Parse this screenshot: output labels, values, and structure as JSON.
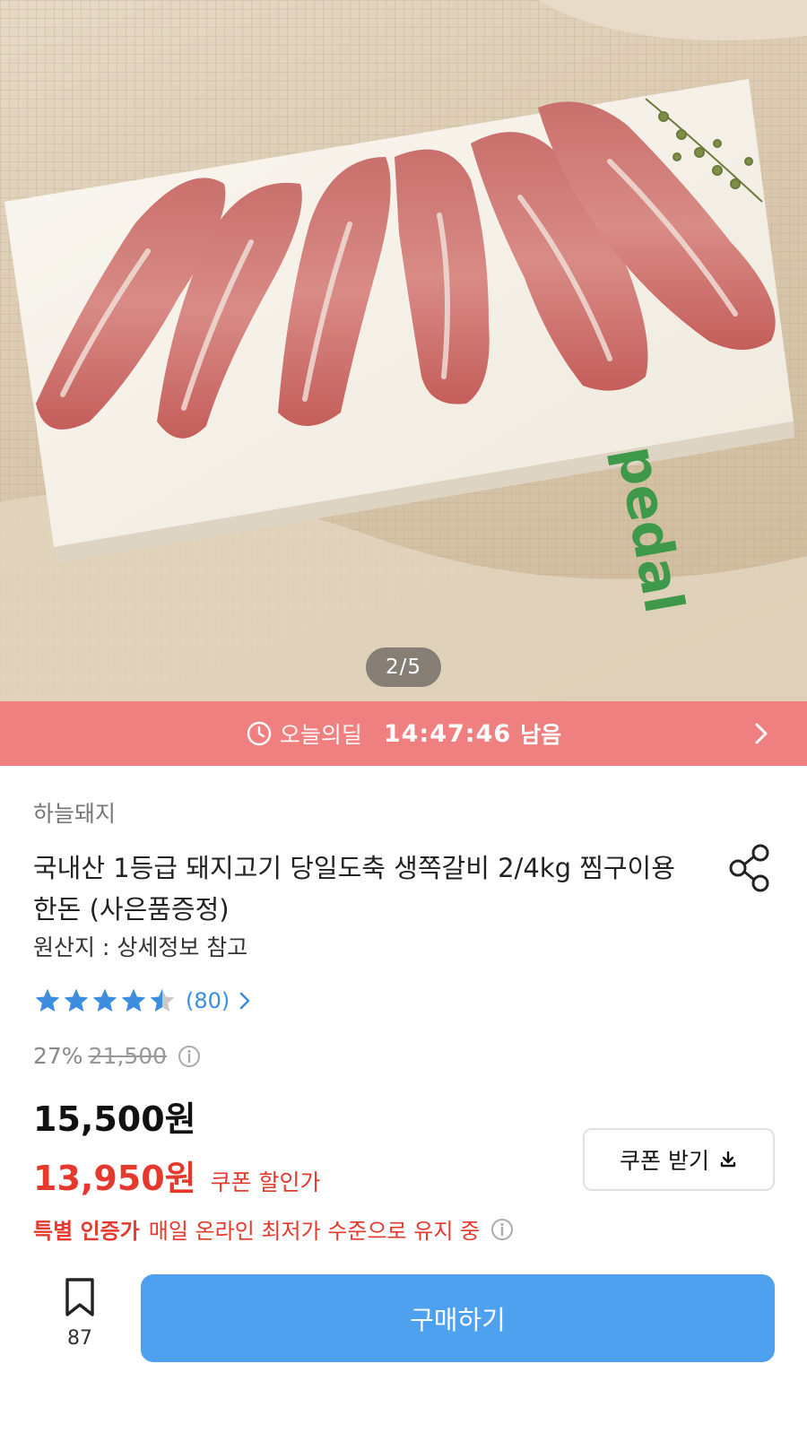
{
  "gallery": {
    "pager": "2/5",
    "image_alt": "raw pork ribs on a white board"
  },
  "deal_banner": {
    "label": "오늘의딜",
    "time": "14:47:46",
    "suffix": "남음",
    "bg_color": "#f07f7f",
    "icon": "clock-icon"
  },
  "product": {
    "brand": "하늘돼지",
    "title": "국내산 1등급 돼지고기 당일도축 생쪽갈비 2/4kg 찜구이용 한돈 (사은품증정)",
    "origin": "원산지 : 상세정보 참고"
  },
  "rating": {
    "stars": 4.5,
    "count": "(80)",
    "star_color": "#3a8ddf"
  },
  "pricing": {
    "discount_pct": "27%",
    "original_price": "21,500",
    "price": "15,500원",
    "coupon_price": "13,950원",
    "coupon_label": "쿠폰 할인가",
    "coupon_button": "쿠폰 받기",
    "accent_color": "#e6392d"
  },
  "special": {
    "strong": "특별 인증가",
    "text": "매일 온라인 최저가 수준으로 유지 중"
  },
  "bottom_bar": {
    "bookmark_count": "87",
    "buy_label": "구매하기",
    "buy_color": "#4ea1ef"
  }
}
